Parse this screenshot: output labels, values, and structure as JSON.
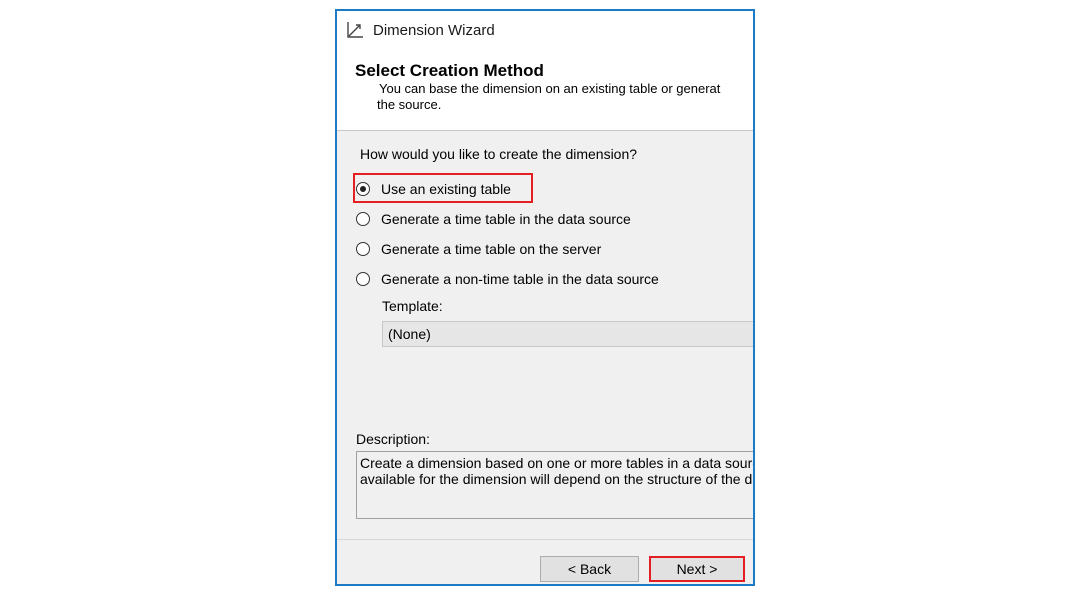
{
  "window": {
    "title": "Dimension Wizard",
    "title_icon": "dimension-wizard-icon"
  },
  "header": {
    "title": "Select Creation Method",
    "description_line1": "You can base the dimension on an existing table or generat",
    "description_line2": "the source."
  },
  "content": {
    "question": "How would you like to create the dimension?",
    "options": [
      {
        "label": "Use an existing table",
        "checked": true
      },
      {
        "label": "Generate a time table in the data source",
        "checked": false
      },
      {
        "label": "Generate a time table on the server",
        "checked": false
      },
      {
        "label": "Generate a non-time table in the data source",
        "checked": false
      }
    ],
    "template_label": "Template:",
    "template_value": "(None)",
    "description_label": "Description:",
    "description_line1": "Create a dimension based on one or more tables in a data sourc",
    "description_line2": "available for the dimension will depend on the structure of the d"
  },
  "footer": {
    "back_label": "< Back",
    "next_label": "Next >"
  },
  "colors": {
    "window_border": "#1c7bc7",
    "highlight": "#e31e24",
    "panel_background": "#f0f0f0"
  }
}
